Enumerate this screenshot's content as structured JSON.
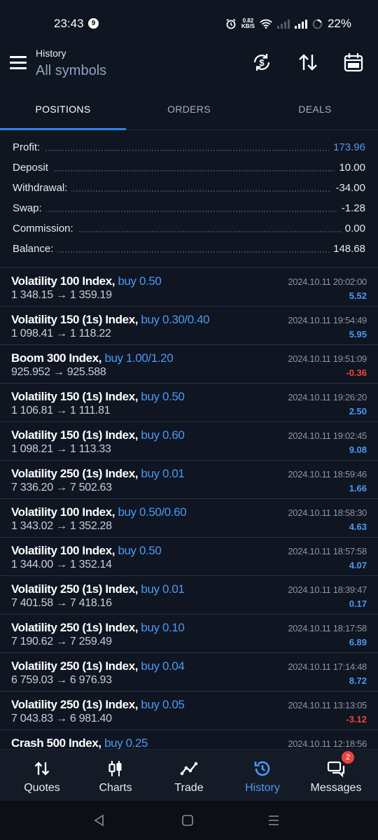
{
  "status_bar": {
    "time": "23:43",
    "notification_count": "9",
    "net_speed_value": "0.82",
    "net_speed_unit": "KB/S",
    "battery": "22%"
  },
  "header": {
    "title": "History",
    "subtitle": "All symbols",
    "actions": [
      "currency-sync-icon",
      "sort-icon",
      "calendar-icon"
    ]
  },
  "tabs": [
    {
      "label": "POSITIONS",
      "active": true
    },
    {
      "label": "ORDERS",
      "active": false
    },
    {
      "label": "DEALS",
      "active": false
    }
  ],
  "summary": [
    {
      "label": "Profit:",
      "value": "173.96"
    },
    {
      "label": "Deposit",
      "value": "10.00"
    },
    {
      "label": "Withdrawal:",
      "value": "-34.00"
    },
    {
      "label": "Swap:",
      "value": "-1.28"
    },
    {
      "label": "Commission:",
      "value": "0.00"
    },
    {
      "label": "Balance:",
      "value": "148.68"
    }
  ],
  "positions": [
    {
      "symbol": "Volatility 100 Index,",
      "side": "buy 0.50",
      "prices": "1 348.15 → 1 359.19",
      "time": "2024.10.11 20:02:00",
      "profit": "5.52"
    },
    {
      "symbol": "Volatility 150 (1s) Index,",
      "side": "buy 0.30/0.40",
      "prices": "1 098.41 → 1 118.22",
      "time": "2024.10.11 19:54:49",
      "profit": "5.95"
    },
    {
      "symbol": "Boom 300 Index,",
      "side": "buy 1.00/1.20",
      "prices": "925.952 → 925.588",
      "time": "2024.10.11 19:51:09",
      "profit": "-0.36"
    },
    {
      "symbol": "Volatility 150 (1s) Index,",
      "side": "buy 0.50",
      "prices": "1 106.81 → 1 111.81",
      "time": "2024.10.11 19:26:20",
      "profit": "2.50"
    },
    {
      "symbol": "Volatility 150 (1s) Index,",
      "side": "buy 0.60",
      "prices": "1 098.21 → 1 113.33",
      "time": "2024.10.11 19:02:45",
      "profit": "9.08"
    },
    {
      "symbol": "Volatility 250 (1s) Index,",
      "side": "buy 0.01",
      "prices": "7 336.20 → 7 502.63",
      "time": "2024.10.11 18:59:46",
      "profit": "1.66"
    },
    {
      "symbol": "Volatility 100 Index,",
      "side": "buy 0.50/0.60",
      "prices": "1 343.02 → 1 352.28",
      "time": "2024.10.11 18:58:30",
      "profit": "4.63"
    },
    {
      "symbol": "Volatility 100 Index,",
      "side": "buy 0.50",
      "prices": "1 344.00 → 1 352.14",
      "time": "2024.10.11 18:57:58",
      "profit": "4.07"
    },
    {
      "symbol": "Volatility 250 (1s) Index,",
      "side": "buy 0.01",
      "prices": "7 401.58 → 7 418.16",
      "time": "2024.10.11 18:39:47",
      "profit": "0.17"
    },
    {
      "symbol": "Volatility 250 (1s) Index,",
      "side": "buy 0.10",
      "prices": "7 190.62 → 7 259.49",
      "time": "2024.10.11 18:17:58",
      "profit": "6.89"
    },
    {
      "symbol": "Volatility 250 (1s) Index,",
      "side": "buy 0.04",
      "prices": "6 759.03 → 6 976.93",
      "time": "2024.10.11 17:14:48",
      "profit": "8.72"
    },
    {
      "symbol": "Volatility 250 (1s) Index,",
      "side": "buy 0.05",
      "prices": "7 043.83 → 6 981.40",
      "time": "2024.10.11 13:13:05",
      "profit": "-3.12"
    },
    {
      "symbol": "Crash 500 Index,",
      "side": "buy 0.25",
      "prices": "",
      "time": "2024.10.11 12:18:56",
      "profit": ""
    }
  ],
  "bottom_nav": [
    {
      "label": "Quotes",
      "icon": "quotes-icon",
      "active": false
    },
    {
      "label": "Charts",
      "icon": "charts-icon",
      "active": false
    },
    {
      "label": "Trade",
      "icon": "trade-icon",
      "active": false
    },
    {
      "label": "History",
      "icon": "history-icon",
      "active": true
    },
    {
      "label": "Messages",
      "icon": "messages-icon",
      "active": false,
      "badge": "2"
    }
  ],
  "colors": {
    "background": "#0f1521",
    "accent_blue": "#4a9af5",
    "loss_red": "#f0453a",
    "tab_underline": "#2f86f0"
  }
}
